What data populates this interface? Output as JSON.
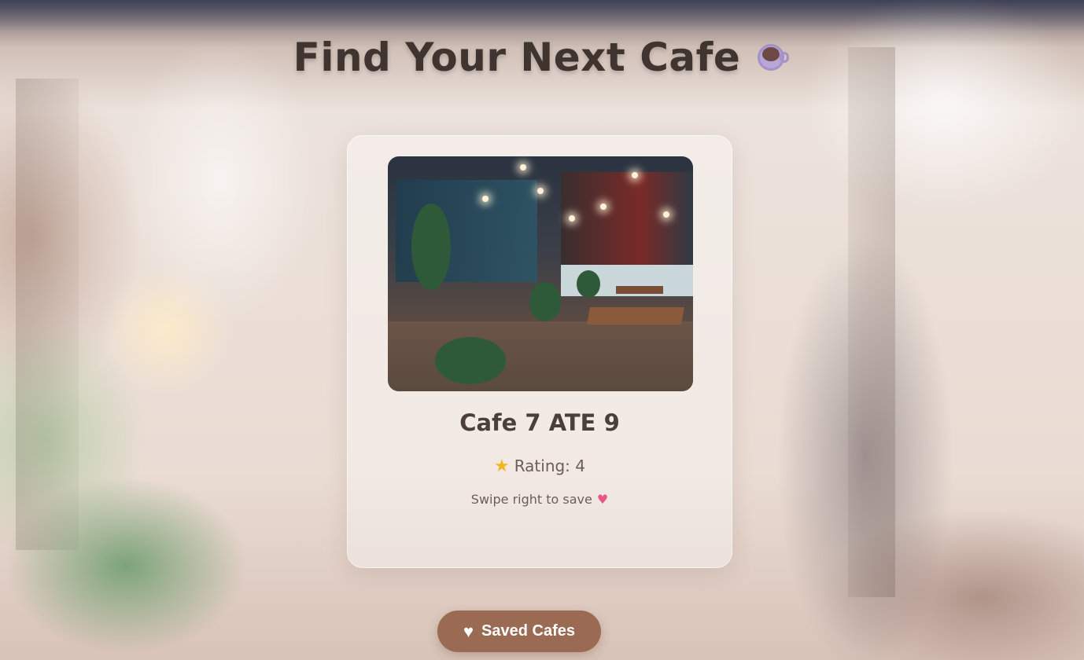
{
  "header": {
    "title": "Find Your Next Cafe",
    "title_icon": "coffee-cup-icon"
  },
  "card": {
    "image_icon": "cafe-photo",
    "name": "Cafe 7 ATE 9",
    "rating_icon": "star-icon",
    "rating_text": "Rating: 4",
    "hint_text": "Swipe right to save",
    "hint_icon": "heart-icon"
  },
  "footer": {
    "saved_button_label": "Saved Cafes",
    "saved_button_icon": "heart-icon"
  },
  "colors": {
    "title": "#3f342f",
    "button_bg": "#9a6a52",
    "star": "#f2b721",
    "heart": "#e8568a"
  }
}
